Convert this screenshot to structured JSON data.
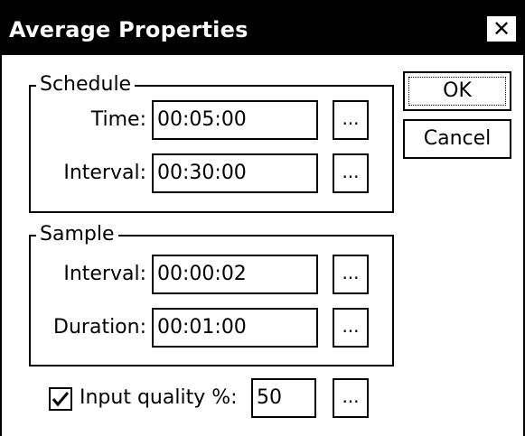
{
  "window": {
    "title": "Average Properties",
    "close_glyph": "✕"
  },
  "buttons": {
    "ok": "OK",
    "cancel": "Cancel",
    "ellipsis": "..."
  },
  "schedule": {
    "legend": "Schedule",
    "time_label": "Time:",
    "time_value": "00:05:00",
    "interval_label": "Interval:",
    "interval_value": "00:30:00"
  },
  "sample": {
    "legend": "Sample",
    "interval_label": "Interval:",
    "interval_value": "00:00:02",
    "duration_label": "Duration:",
    "duration_value": "00:01:00"
  },
  "quality": {
    "checked": true,
    "label": "Input quality %:",
    "value": "50"
  }
}
